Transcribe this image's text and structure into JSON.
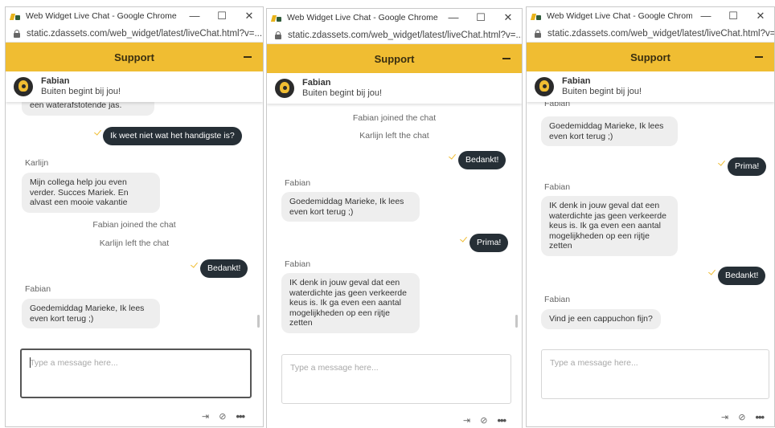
{
  "browser": {
    "window_title": "Web Widget Live Chat - Google Chrome",
    "url": "static.zdassets.com/web_widget/latest/liveChat.html?v=...",
    "controls": {
      "minimize": "—",
      "maximize": "☐",
      "close": "✕"
    }
  },
  "widget": {
    "header_title": "Support",
    "agent_name": "Fabian",
    "agent_tagline": "Buiten begint bij jou!",
    "input_placeholder": "Type a message here...",
    "footer_icons": [
      "transfer-icon",
      "attach-icon",
      "more-icon"
    ],
    "accent_color": "#f0bd32",
    "outgoing_bubble_color": "#262f36"
  },
  "screens": [
    {
      "messages": {
        "clipped_in": "een waterafstotende jas.",
        "out_1": "Ik weet niet wat het handigste is?",
        "sender_karlijn": "Karlijn",
        "in_karlijn": "Mijn collega help jou even verder. Succes Mariek. En alvast een mooie vakantie",
        "system_joined": "Fabian joined the chat",
        "system_left": "Karlijn left the chat",
        "out_2": "Bedankt!",
        "sender_fabian": "Fabian",
        "in_fabian": "Goedemiddag Marieke, Ik lees even kort terug ;)"
      }
    },
    {
      "messages": {
        "system_joined": "Fabian joined the chat",
        "system_left": "Karlijn left the chat",
        "out_1": "Bedankt!",
        "sender_1": "Fabian",
        "in_1": "Goedemiddag Marieke, Ik lees even kort terug ;)",
        "out_2": "Prima!",
        "sender_2": "Fabian",
        "in_2": "IK denk in jouw geval dat een waterdichte jas geen verkeerde keus is. Ik ga even een aantal mogelijkheden op een rijtje zetten"
      }
    },
    {
      "messages": {
        "clipped_sender": "Fabian",
        "in_1": "Goedemiddag Marieke, Ik lees even kort terug ;)",
        "out_1": "Prima!",
        "sender_2": "Fabian",
        "in_2": "IK denk in jouw geval dat een waterdichte jas geen verkeerde keus is. Ik ga even een aantal mogelijkheden op een rijtje zetten",
        "out_2": "Bedankt!",
        "sender_3": "Fabian",
        "in_3": "Vind je een cappuchon fijn?"
      }
    }
  ]
}
